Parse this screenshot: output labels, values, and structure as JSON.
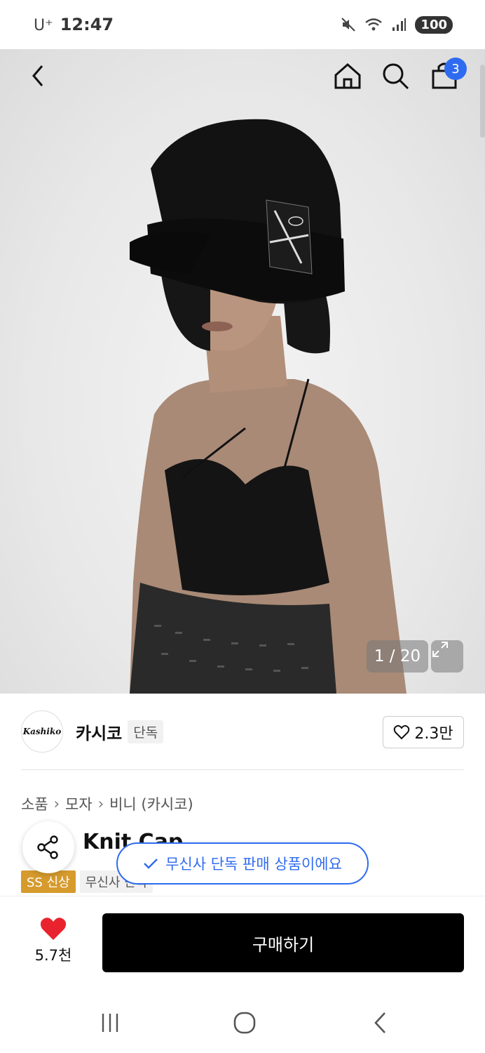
{
  "status_bar": {
    "carrier": "U⁺",
    "time": "12:47",
    "battery": "100"
  },
  "header": {
    "cart_count": "3"
  },
  "gallery": {
    "counter": "1 / 20",
    "current": 1,
    "total": 20
  },
  "brand": {
    "logo_text": "Kashiko",
    "name": "카시코",
    "exclusive_tag": "단독",
    "likes": "2.3만"
  },
  "breadcrumb": [
    "소품",
    "모자",
    "비니 (카시코)"
  ],
  "product": {
    "title": "Knit Cap",
    "tags": {
      "new": "SS 신상",
      "exclusive": "무신사 단독"
    }
  },
  "toast": {
    "text": "무신사 단독 판매 상품이에요"
  },
  "bottom": {
    "wish_count": "5.7천",
    "buy_label": "구매하기"
  },
  "icons": {
    "back": "chevron-left-icon",
    "home": "home-icon",
    "search": "search-icon",
    "cart": "shopping-bag-icon",
    "expand": "expand-icon",
    "heart": "heart-icon",
    "share": "share-icon",
    "check": "check-icon"
  },
  "colors": {
    "accent": "#2f6bf0",
    "new_tag": "#d69a2d",
    "heart": "#e8232d",
    "buy_button": "#000000"
  }
}
